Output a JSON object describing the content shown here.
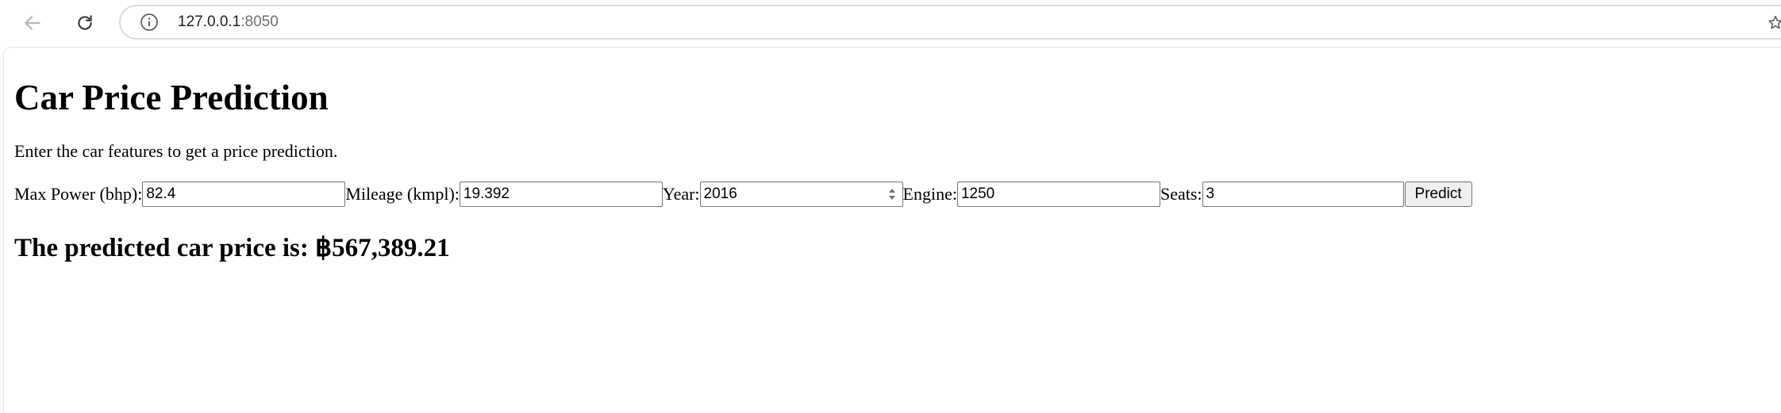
{
  "browser": {
    "url_host": "127.0.0.1",
    "url_port": ":8050"
  },
  "page": {
    "title": "Car Price Prediction",
    "instructions": "Enter the car features to get a price prediction.",
    "form": {
      "max_power_label": "Max Power (bhp):",
      "max_power_value": "82.4",
      "mileage_label": "Mileage (kmpl):",
      "mileage_value": "19.392",
      "year_label": "Year:",
      "year_value": "2016",
      "engine_label": "Engine:",
      "engine_value": "1250",
      "seats_label": "Seats:",
      "seats_value": "3",
      "predict_label": "Predict"
    },
    "result": "The predicted car price is: ฿567,389.21"
  },
  "icons": {
    "back": "arrow-left-icon",
    "reload": "reload-icon",
    "info": "info-icon",
    "bookmark": "star-icon"
  }
}
